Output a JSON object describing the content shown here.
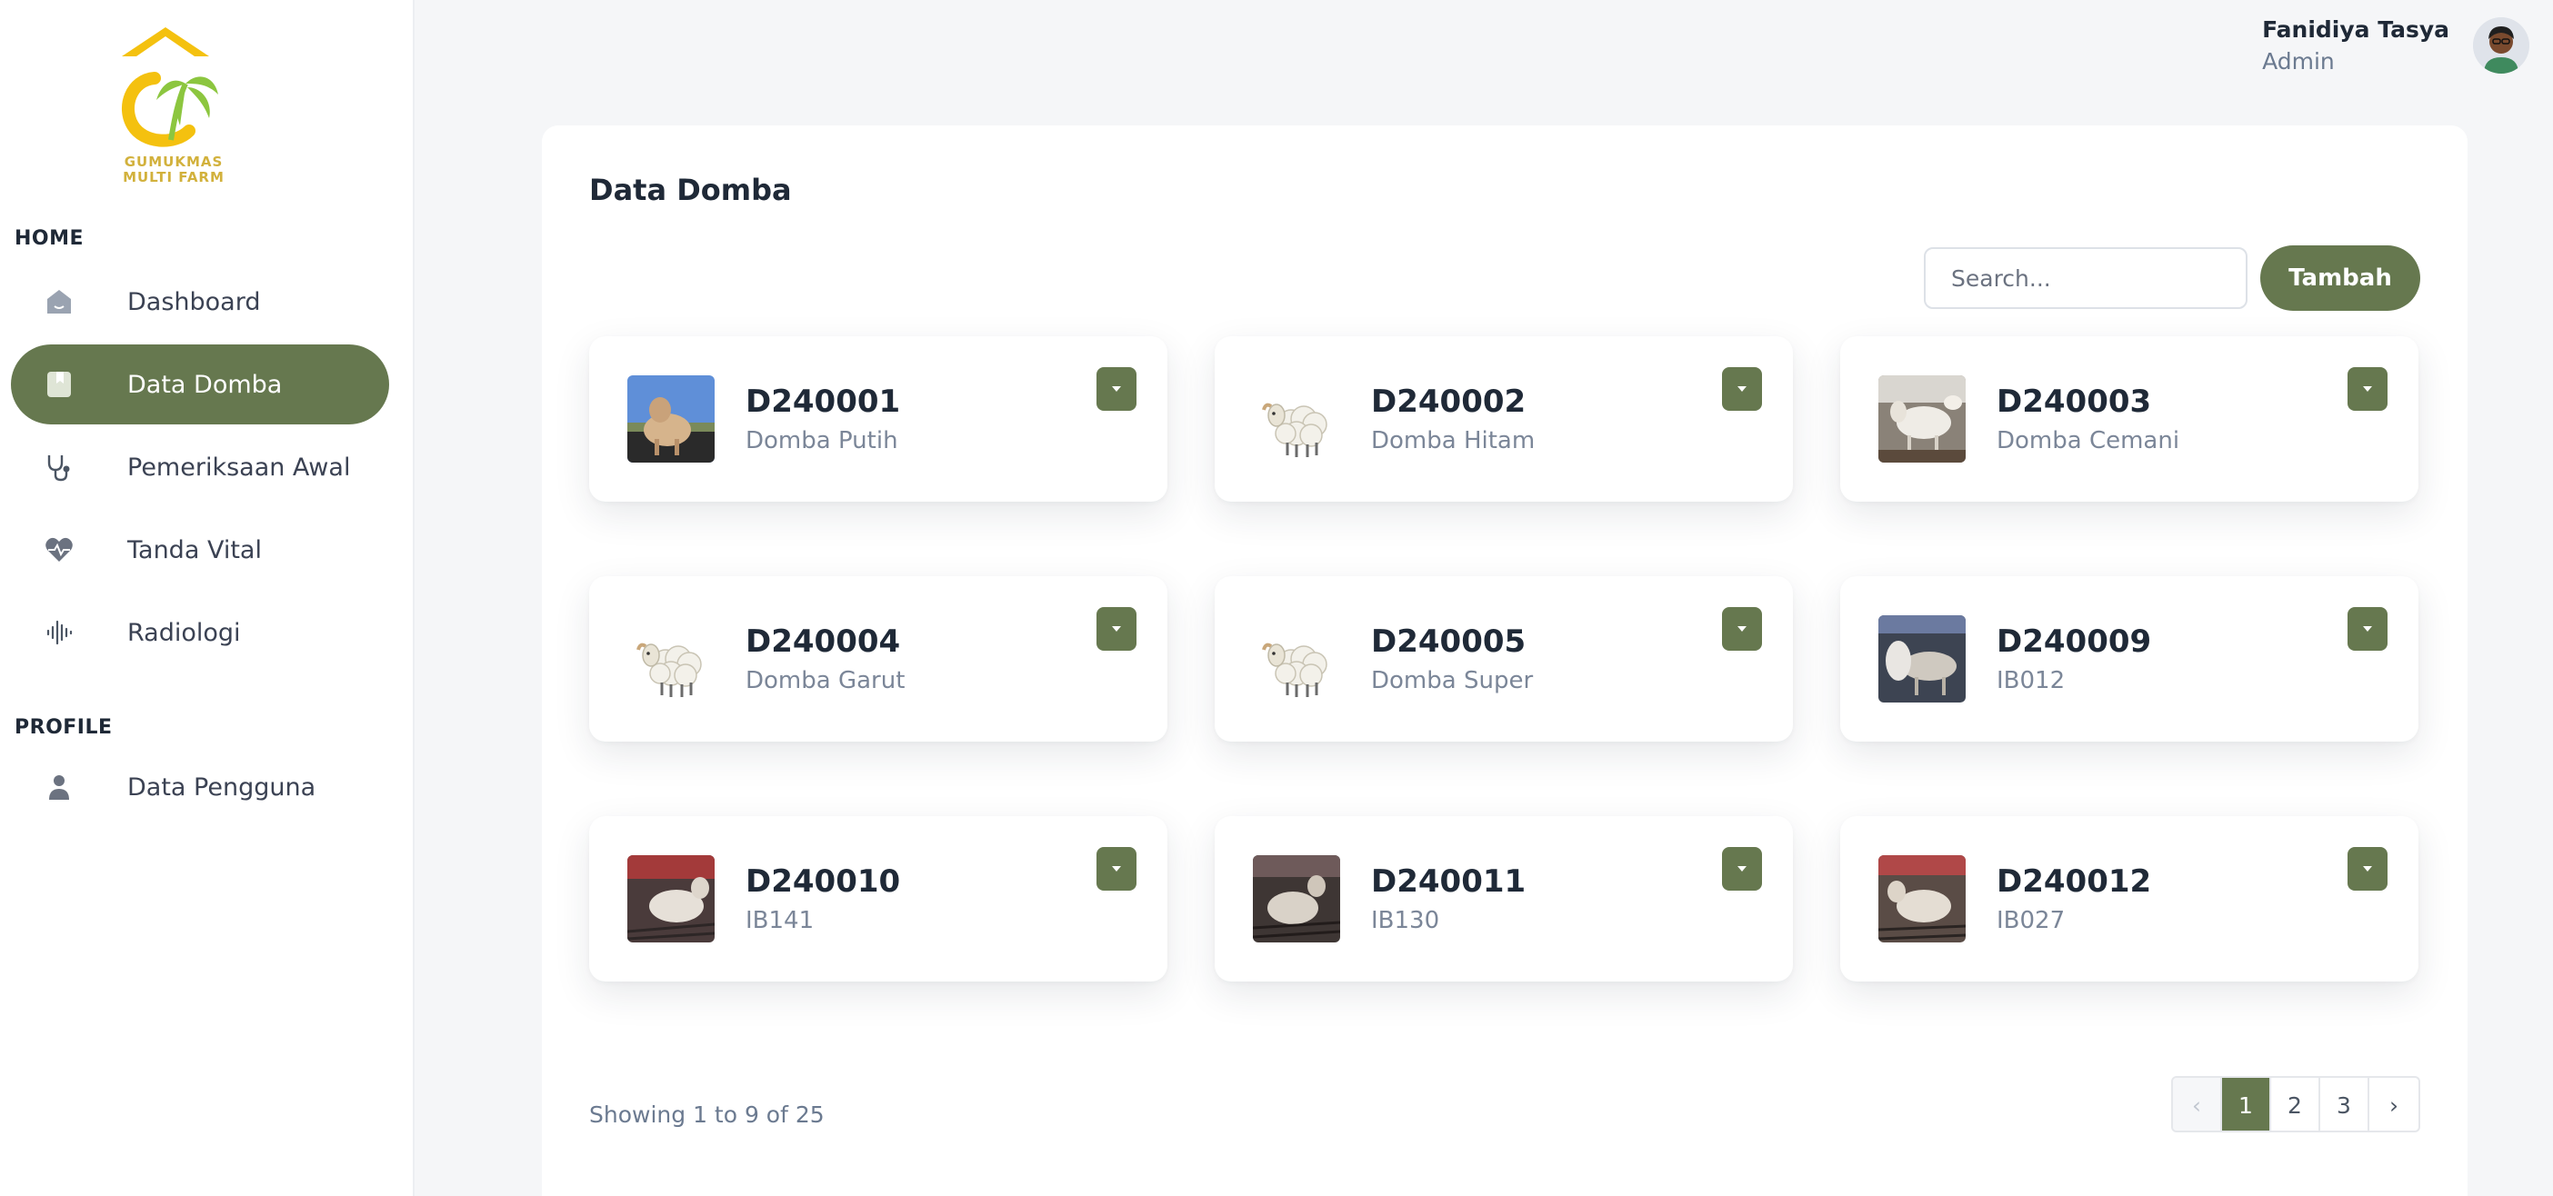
{
  "brand": {
    "logo_text": "GUMUKMAS\nMULTI FARM"
  },
  "sidebar": {
    "sections": [
      {
        "label": "HOME"
      },
      {
        "label": "PROFILE"
      }
    ],
    "items": [
      {
        "label": "Dashboard",
        "icon": "home-icon"
      },
      {
        "label": "Data Domba",
        "icon": "bookmark-icon",
        "active": true
      },
      {
        "label": "Pemeriksaan Awal",
        "icon": "stethoscope-icon"
      },
      {
        "label": "Tanda Vital",
        "icon": "heart-pulse-icon"
      },
      {
        "label": "Radiologi",
        "icon": "waveform-icon"
      },
      {
        "label": "Data Pengguna",
        "icon": "user-icon"
      }
    ]
  },
  "user": {
    "name": "Fanidiya Tasya",
    "role": "Admin"
  },
  "main": {
    "title": "Data Domba",
    "search_placeholder": "Search...",
    "add_label": "Tambah",
    "cards": [
      {
        "id": "D240001",
        "name": "Domba Putih",
        "thumb": "photo"
      },
      {
        "id": "D240002",
        "name": "Domba Hitam",
        "thumb": "sheep-emoji"
      },
      {
        "id": "D240003",
        "name": "Domba Cemani",
        "thumb": "photo"
      },
      {
        "id": "D240004",
        "name": "Domba Garut",
        "thumb": "sheep-emoji"
      },
      {
        "id": "D240005",
        "name": "Domba Super",
        "thumb": "sheep-emoji"
      },
      {
        "id": "D240009",
        "name": "IB012",
        "thumb": "photo"
      },
      {
        "id": "D240010",
        "name": "IB141",
        "thumb": "photo"
      },
      {
        "id": "D240011",
        "name": "IB130",
        "thumb": "photo"
      },
      {
        "id": "D240012",
        "name": "IB027",
        "thumb": "photo"
      }
    ],
    "showing_text": "Showing 1 to 9 of 25",
    "pagination": {
      "prev": "‹",
      "pages": [
        "1",
        "2",
        "3"
      ],
      "next": "›",
      "current": "1"
    }
  },
  "colors": {
    "accent": "#66784f",
    "logo_yellow": "#f4c10f",
    "logo_green": "#8cc63f"
  }
}
